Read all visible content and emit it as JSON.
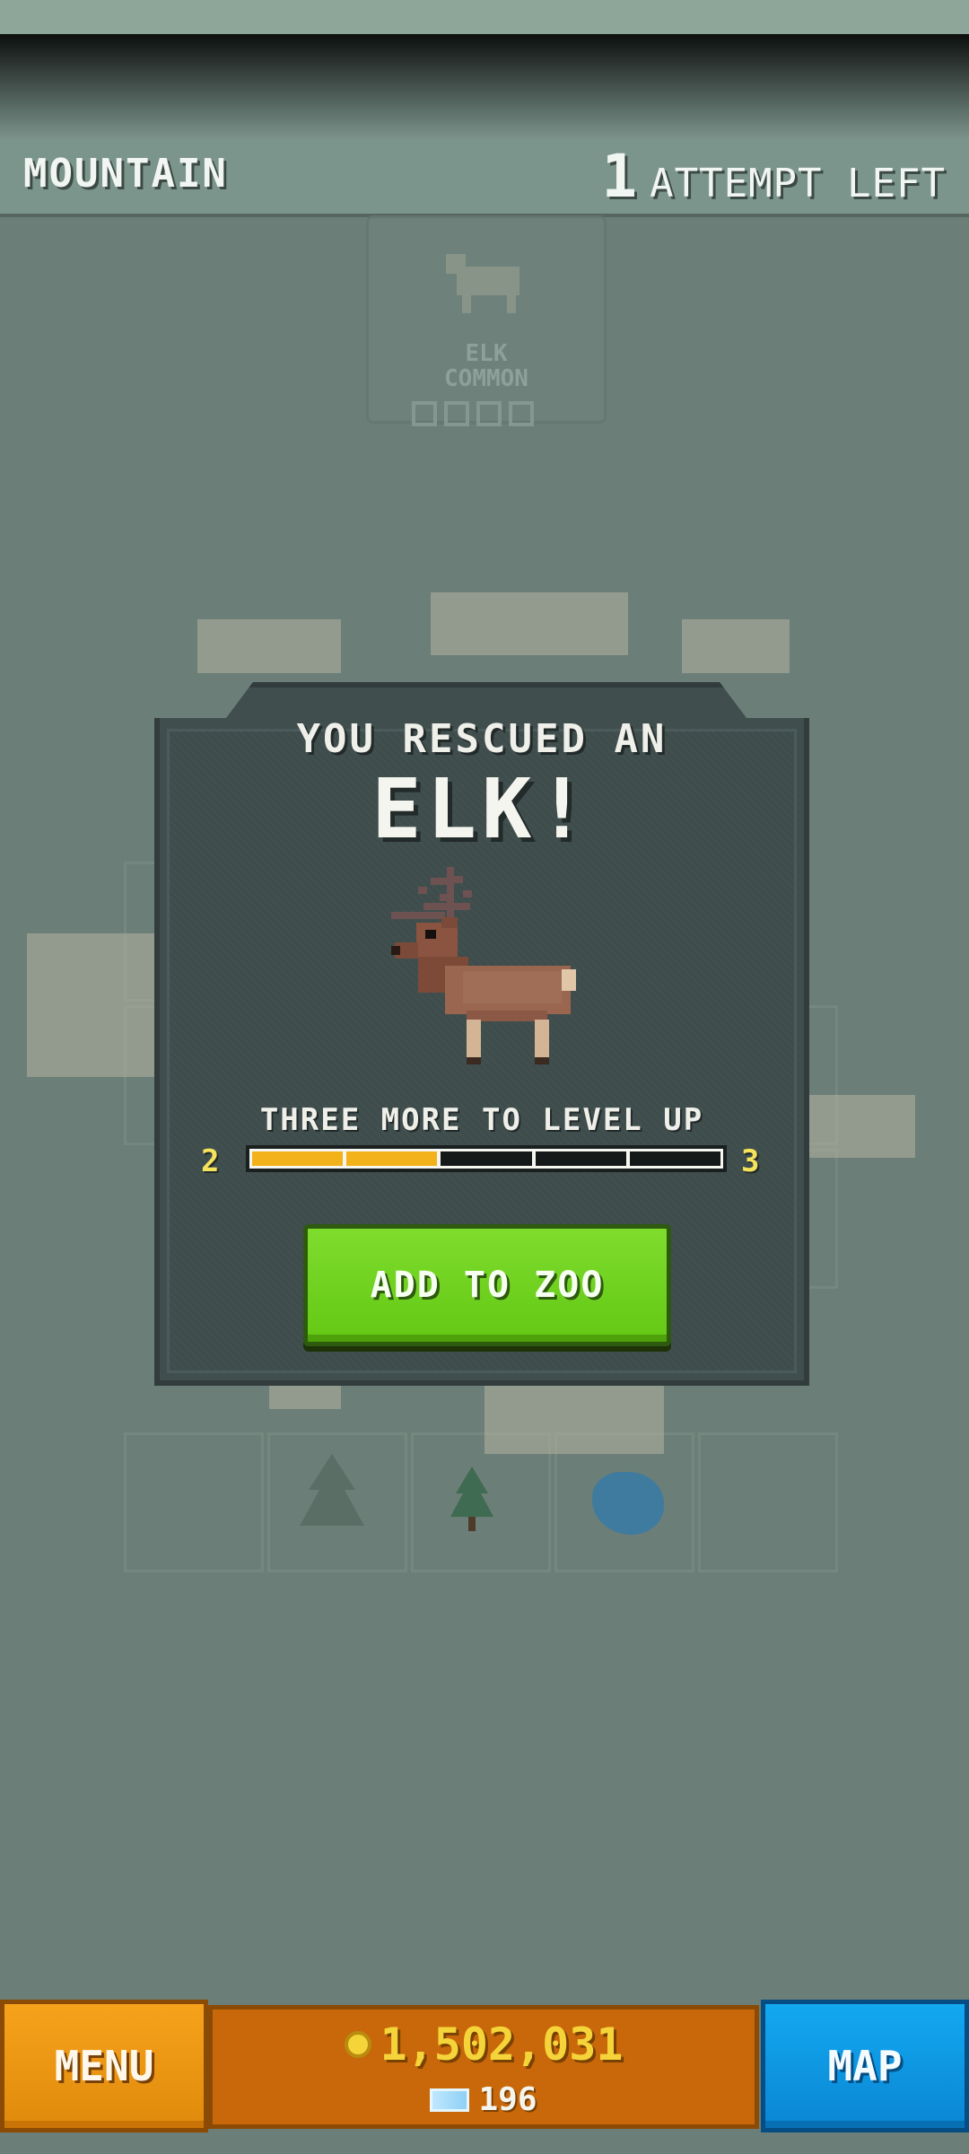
{
  "hud": {
    "region": "MOUNTAIN",
    "attempts_count": "1",
    "attempts_label": "ATTEMPT LEFT"
  },
  "background_card": {
    "animal": "ELK",
    "rarity": "COMMON"
  },
  "modal": {
    "heading": "YOU RESCUED AN",
    "animal": "ELK!",
    "level_text": "THREE MORE TO LEVEL UP",
    "level_from": "2",
    "level_to": "3",
    "progress_filled_segments": 2,
    "progress_total_segments": 5,
    "button_label": "ADD TO ZOO"
  },
  "footer": {
    "menu_label": "MENU",
    "coins": "1,502,031",
    "gems": "196",
    "map_label": "MAP",
    "coin_icon": "coin-icon",
    "gem_icon": "gem-icon"
  },
  "colors": {
    "accent_green": "#63c814",
    "progress_fill": "#f3b21a",
    "menu_orange": "#f7a21b",
    "map_blue": "#13a8f0"
  }
}
